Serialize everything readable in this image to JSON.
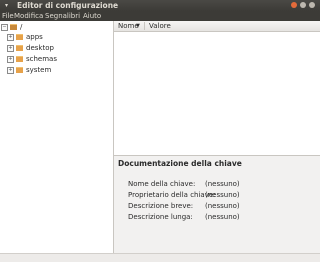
{
  "window": {
    "title": "Editor di configurazione",
    "menu_icon": "window-menu-icon"
  },
  "menubar": {
    "items": [
      "File",
      "Modifica",
      "Segnalibri",
      "Aiuto"
    ]
  },
  "tree": {
    "root": {
      "label": "/",
      "expander": "−"
    },
    "items": [
      {
        "label": "apps",
        "expander": "+"
      },
      {
        "label": "desktop",
        "expander": "+"
      },
      {
        "label": "schemas",
        "expander": "+"
      },
      {
        "label": "system",
        "expander": "+"
      }
    ]
  },
  "list": {
    "columns": [
      "Nome",
      "Valore"
    ],
    "sort_indicator": "▼"
  },
  "documentation": {
    "heading": "Documentazione della chiave",
    "rows": [
      {
        "label": "Nome della chiave:",
        "value": "(nessuno)"
      },
      {
        "label": "Proprietario della chiave:",
        "value": "(nessuno)"
      },
      {
        "label": "Descrizione breve:",
        "value": "(nessuno)"
      },
      {
        "label": "Descrizione lunga:",
        "value": "(nessuno)"
      }
    ]
  },
  "colors": {
    "titlebar": "#3c3b37",
    "close_button": "#e46b3a",
    "folder": "#e7a24a"
  }
}
